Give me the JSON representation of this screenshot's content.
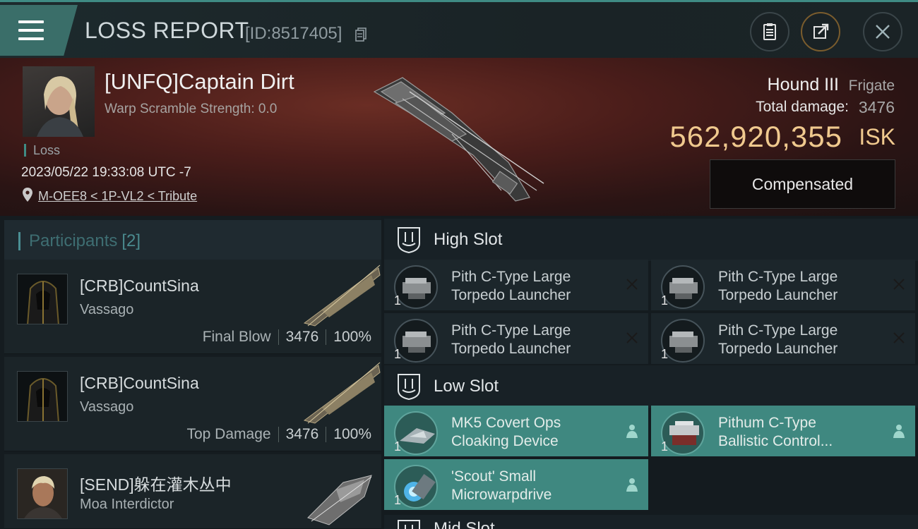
{
  "header": {
    "title": "LOSS REPORT",
    "report_id": "[ID:8517405]"
  },
  "hero": {
    "pilot_name": "[UNFQ]Captain Dirt",
    "warp_scramble": "Warp Scramble Strength: 0.0",
    "result_tag": "Loss",
    "datetime": "2023/05/22 19:33:08 UTC -7",
    "location": "M-OEE8 < 1P-VL2 < Tribute",
    "ship_name": "Hound III",
    "ship_class": "Frigate",
    "total_damage_label": "Total damage:",
    "total_damage": "3476",
    "isk_value": "562,920,355",
    "isk_unit": "ISK",
    "compensated_label": "Compensated"
  },
  "participants": {
    "title": "Participants",
    "count": "[2]",
    "items": [
      {
        "name": "[CRB]CountSina",
        "ship": "Vassago",
        "role": "Final Blow",
        "damage": "3476",
        "percent": "100%"
      },
      {
        "name": "[CRB]CountSina",
        "ship": "Vassago",
        "role": "Top Damage",
        "damage": "3476",
        "percent": "100%"
      },
      {
        "name": "[SEND]躲在灌木丛中",
        "ship": "Moa Interdictor"
      }
    ]
  },
  "slots": {
    "high": {
      "title": "High Slot",
      "items": [
        {
          "qty": "1",
          "line1": "Pith C-Type Large",
          "line2": "Torpedo Launcher"
        },
        {
          "qty": "1",
          "line1": "Pith C-Type Large",
          "line2": "Torpedo Launcher"
        },
        {
          "qty": "1",
          "line1": "Pith C-Type Large",
          "line2": "Torpedo Launcher"
        },
        {
          "qty": "1",
          "line1": "Pith C-Type Large",
          "line2": "Torpedo Launcher"
        }
      ]
    },
    "low": {
      "title": "Low Slot",
      "items": [
        {
          "qty": "1",
          "line1": "MK5 Covert Ops",
          "line2": "Cloaking Device"
        },
        {
          "qty": "1",
          "line1": "Pithum C-Type",
          "line2": "Ballistic Control..."
        },
        {
          "qty": "1",
          "line1": "'Scout' Small",
          "line2": "Microwarpdrive"
        }
      ]
    },
    "mid": {
      "title": "Mid Slot"
    }
  },
  "colors": {
    "accent": "#3f8b84",
    "isk": "#f0c98e",
    "dropped_item": "#3f8880"
  }
}
